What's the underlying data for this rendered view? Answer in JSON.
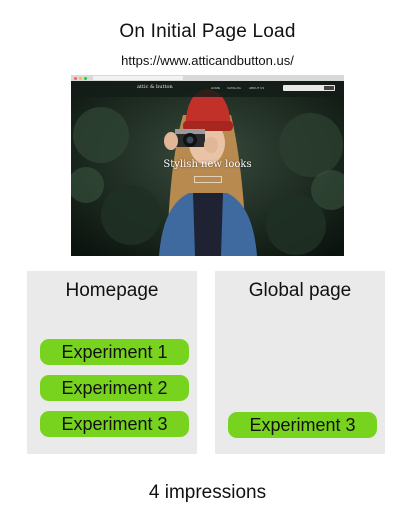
{
  "header": {
    "title": "On Initial Page Load",
    "url": "https://www.atticandbutton.us/"
  },
  "screenshot": {
    "site_name": "attic & button",
    "nav_links": [
      "HOME",
      "CATALOG",
      "ABOUT US"
    ],
    "tagline": "Stylish new looks"
  },
  "homepage_box": {
    "title": "Homepage",
    "experiments": [
      "Experiment 1",
      "Experiment 2",
      "Experiment 3"
    ]
  },
  "global_box": {
    "title": "Global page",
    "experiments": [
      "Experiment 3"
    ]
  },
  "footer": {
    "impressions": "4 impressions"
  },
  "colors": {
    "experiment_pill": "#78d31f",
    "box_background": "#eaeaea"
  }
}
